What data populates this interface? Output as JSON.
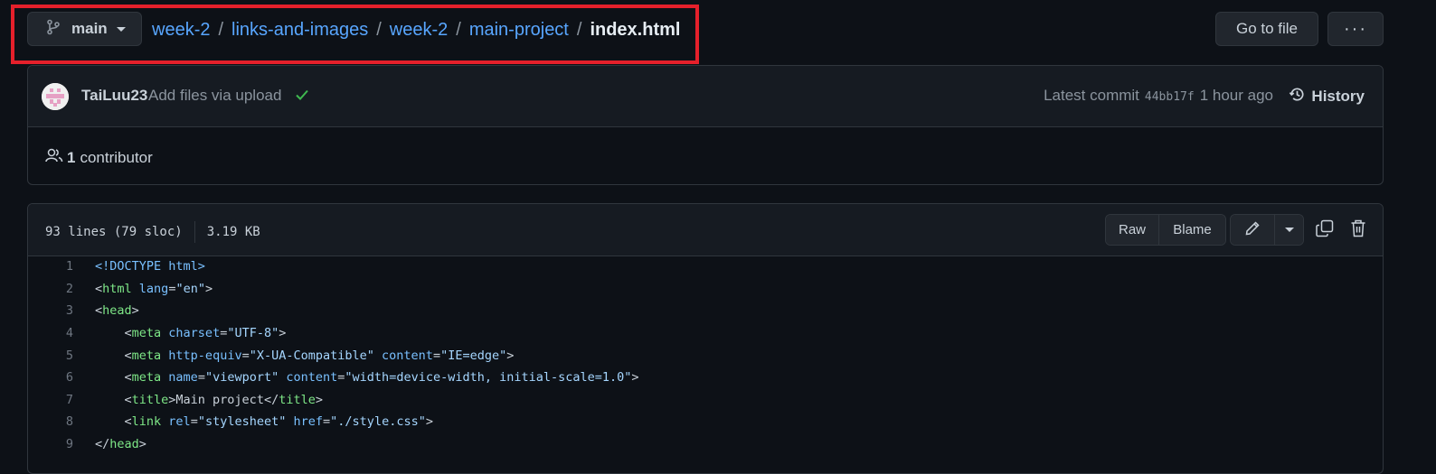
{
  "branch": {
    "name": "main",
    "icon": "git-branch-icon"
  },
  "breadcrumb": {
    "parts": [
      "week-2",
      "links-and-images",
      "week-2",
      "main-project"
    ],
    "separator": "/",
    "current": "index.html"
  },
  "actions": {
    "goto_label": "Go to file",
    "more_label": "···"
  },
  "commit": {
    "author": "TaiLuu23",
    "message": "Add files via upload",
    "latest_label": "Latest commit",
    "sha": "44bb17f",
    "time": "1 hour ago",
    "history_label": "History"
  },
  "contributors": {
    "count": "1",
    "label": "contributor"
  },
  "file": {
    "lines_info": "93 lines (79 sloc)",
    "size": "3.19 KB",
    "raw_label": "Raw",
    "blame_label": "Blame"
  },
  "code_lines": [
    {
      "n": "1",
      "html": "<span class=\"attr\">&lt;!DOCTYPE html&gt;</span>"
    },
    {
      "n": "2",
      "html": "&lt;<span class=\"tag\">html</span> <span class=\"attr\">lang</span>=<span class=\"str\">\"en\"</span>&gt;"
    },
    {
      "n": "3",
      "html": "&lt;<span class=\"tag\">head</span>&gt;"
    },
    {
      "n": "4",
      "html": "    &lt;<span class=\"tag\">meta</span> <span class=\"attr\">charset</span>=<span class=\"str\">\"UTF-8\"</span>&gt;"
    },
    {
      "n": "5",
      "html": "    &lt;<span class=\"tag\">meta</span> <span class=\"attr\">http-equiv</span>=<span class=\"str\">\"X-UA-Compatible\"</span> <span class=\"attr\">content</span>=<span class=\"str\">\"IE=edge\"</span>&gt;"
    },
    {
      "n": "6",
      "html": "    &lt;<span class=\"tag\">meta</span> <span class=\"attr\">name</span>=<span class=\"str\">\"viewport\"</span> <span class=\"attr\">content</span>=<span class=\"str\">\"width=device-width, initial-scale=1.0\"</span>&gt;"
    },
    {
      "n": "7",
      "html": "    &lt;<span class=\"tag\">title</span>&gt;Main project&lt;/<span class=\"tag\">title</span>&gt;"
    },
    {
      "n": "8",
      "html": "    &lt;<span class=\"tag\">link</span> <span class=\"attr\">rel</span>=<span class=\"str\">\"stylesheet\"</span> <span class=\"attr\">href</span>=<span class=\"str\">\"./style.css\"</span>&gt;"
    },
    {
      "n": "9",
      "html": "&lt;/<span class=\"tag\">head</span>&gt;"
    }
  ],
  "colors": {
    "link": "#58a6ff",
    "background": "#0d1117",
    "highlight": "#e5202b",
    "success": "#3fb950"
  }
}
